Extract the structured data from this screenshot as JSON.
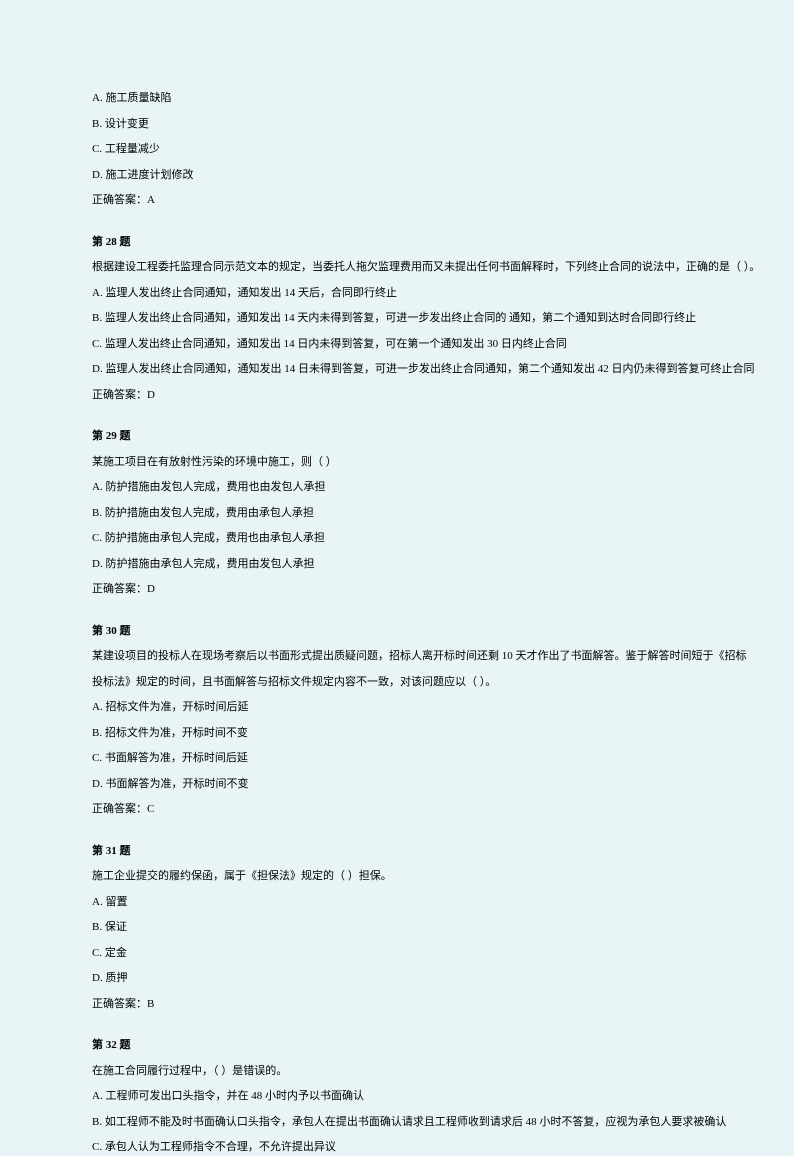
{
  "q27": {
    "optA": "A. 施工质量缺陷",
    "optB": "B. 设计变更",
    "optC": "C. 工程量减少",
    "optD": "D. 施工进度计划修改",
    "answer": "正确答案：A"
  },
  "q28": {
    "title": "第 28 题",
    "stem": "根据建设工程委托监理合同示范文本的规定，当委托人拖欠监理费用而又未提出任何书面解释时，下列终止合同的说法中，正确的是（  ）。",
    "optA": "A. 监理人发出终止合同通知，通知发出 14 天后，合同即行终止",
    "optB": "B. 监理人发出终止合同通知，通知发出 14 天内未得到答复，可进一步发出终止合同的   通知，第二个通知到达时合同即行终止",
    "optC": "C. 监理人发出终止合同通知，通知发出 14 日内未得到答复，可在第一个通知发出 30 日内终止合同",
    "optD": "D. 监理人发出终止合同通知，通知发出 14 日未得到答复，可进一步发出终止合同通知，第二个通知发出 42 日内仍未得到答复可终止合同",
    "answer": "正确答案：D"
  },
  "q29": {
    "title": "第 29 题",
    "stem": "某施工项目在有放射性污染的环境中施工，则（   ）",
    "optA": "A. 防护措施由发包人完成，费用也由发包人承担",
    "optB": "B. 防护措施由发包人完成，费用由承包人承担",
    "optC": "C. 防护措施由承包人完成，费用也由承包人承担",
    "optD": "D. 防护措施由承包人完成，费用由发包人承担",
    "answer": "正确答案：D"
  },
  "q30": {
    "title": "第 30 题",
    "stem1": "某建设项目的投标人在现场考察后以书面形式提出质疑问题，招标人离开标时间还剩 10 天才作出了书面解答。鉴于解答时间短于《招标",
    "stem2": "投标法》规定的时间，且书面解答与招标文件规定内容不一致，对该问题应以（   ）。",
    "optA": "A. 招标文件为准，开标时间后延",
    "optB": "B. 招标文件为准，开标时间不变",
    "optC": "C. 书面解答为准，开标时间后延",
    "optD": "D. 书面解答为准，开标时间不变",
    "answer": "正确答案：C"
  },
  "q31": {
    "title": "第 31 题",
    "stem": "施工企业提交的履约保函，属于《担保法》规定的（   ）担保。",
    "optA": "A. 留置",
    "optB": "B. 保证",
    "optC": "C. 定金",
    "optD": "D. 质押",
    "answer": "正确答案：B"
  },
  "q32": {
    "title": "第 32 题",
    "stem": "在施工合同履行过程中，（   ）是错误的。",
    "optA": "A. 工程师可发出口头指令，并在 48 小时内予以书面确认",
    "optB": "B. 如工程师不能及时书面确认口头指令，承包人在提出书面确认请求且工程师收到请求后 48 小时不答复，应视为承包人要求被确认",
    "optC": "C. 承包人认为工程师指令不合理，不允许提出异议"
  }
}
